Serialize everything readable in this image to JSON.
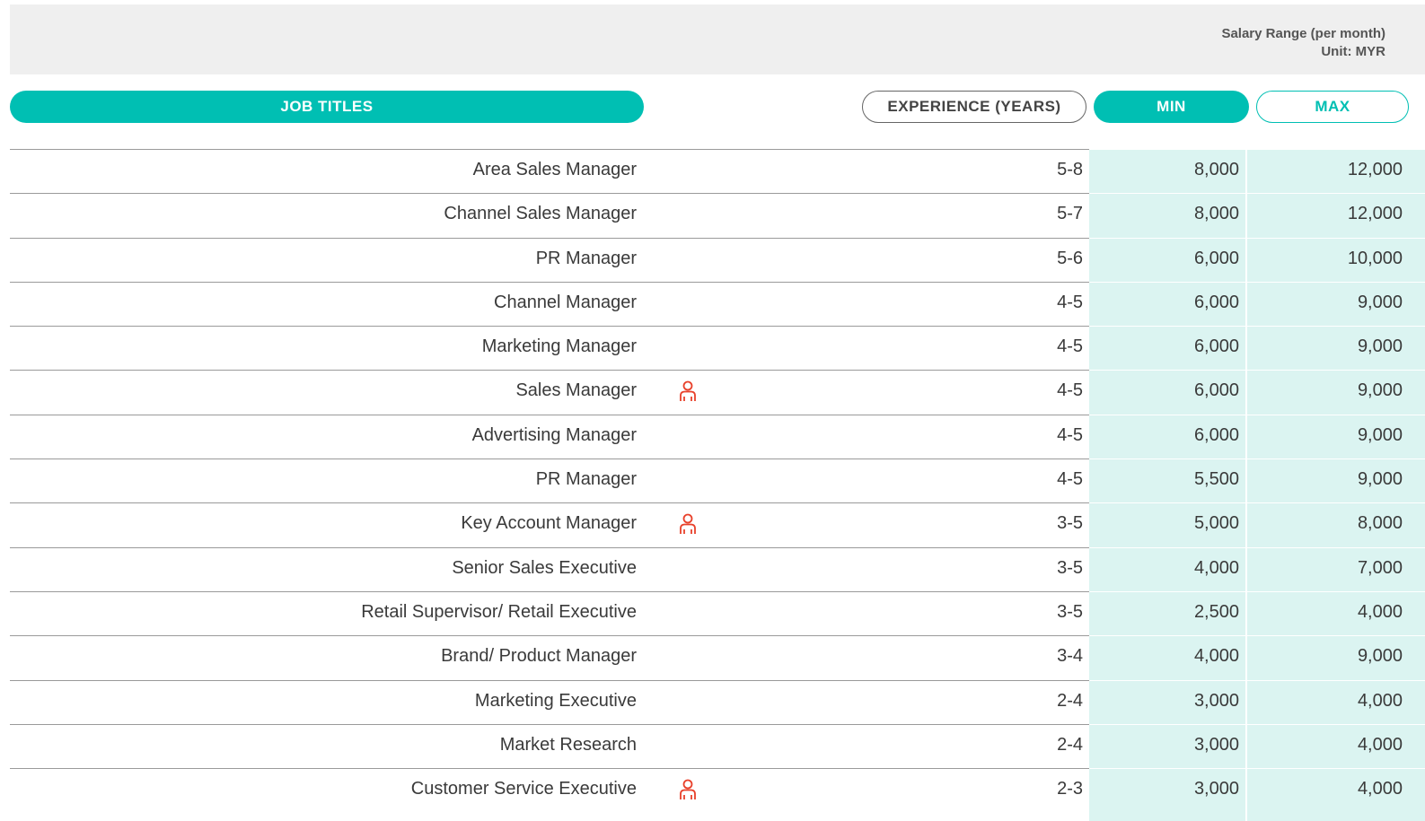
{
  "salary_note": {
    "line1": "Salary Range (per month)",
    "line2": "Unit: MYR"
  },
  "headers": {
    "job_titles": "JOB TITLES",
    "experience": "EXPERIENCE (YEARS)",
    "min": "MIN",
    "max": "MAX"
  },
  "colors": {
    "accent": "#00bfb3",
    "shade": "#dbf4f1",
    "icon": "#e8402a"
  },
  "rows": [
    {
      "title": "Area Sales Manager",
      "experience": "5-8",
      "min": "8,000",
      "max": "12,000",
      "icon": ""
    },
    {
      "title": "Channel Sales Manager",
      "experience": "5-7",
      "min": "8,000",
      "max": "12,000",
      "icon": ""
    },
    {
      "title": "PR Manager",
      "experience": "5-6",
      "min": "6,000",
      "max": "10,000",
      "icon": ""
    },
    {
      "title": "Channel Manager",
      "experience": "4-5",
      "min": "6,000",
      "max": "9,000",
      "icon": ""
    },
    {
      "title": "Marketing Manager",
      "experience": "4-5",
      "min": "6,000",
      "max": "9,000",
      "icon": ""
    },
    {
      "title": "Sales Manager",
      "experience": "4-5",
      "min": "6,000",
      "max": "9,000",
      "icon": "person-icon"
    },
    {
      "title": "Advertising Manager",
      "experience": "4-5",
      "min": "6,000",
      "max": "9,000",
      "icon": ""
    },
    {
      "title": "PR Manager",
      "experience": "4-5",
      "min": "5,500",
      "max": "9,000",
      "icon": ""
    },
    {
      "title": "Key Account Manager",
      "experience": "3-5",
      "min": "5,000",
      "max": "8,000",
      "icon": "person-icon"
    },
    {
      "title": "Senior Sales Executive",
      "experience": "3-5",
      "min": "4,000",
      "max": "7,000",
      "icon": ""
    },
    {
      "title": "Retail Supervisor/ Retail Executive",
      "experience": "3-5",
      "min": "2,500",
      "max": "4,000",
      "icon": ""
    },
    {
      "title": "Brand/ Product Manager",
      "experience": "3-4",
      "min": "4,000",
      "max": "9,000",
      "icon": ""
    },
    {
      "title": "Marketing Executive",
      "experience": "2-4",
      "min": "3,000",
      "max": "4,000",
      "icon": ""
    },
    {
      "title": "Market Research",
      "experience": "2-4",
      "min": "3,000",
      "max": "4,000",
      "icon": ""
    },
    {
      "title": "Customer Service Executive",
      "experience": "2-3",
      "min": "3,000",
      "max": "4,000",
      "icon": "person-icon"
    }
  ]
}
